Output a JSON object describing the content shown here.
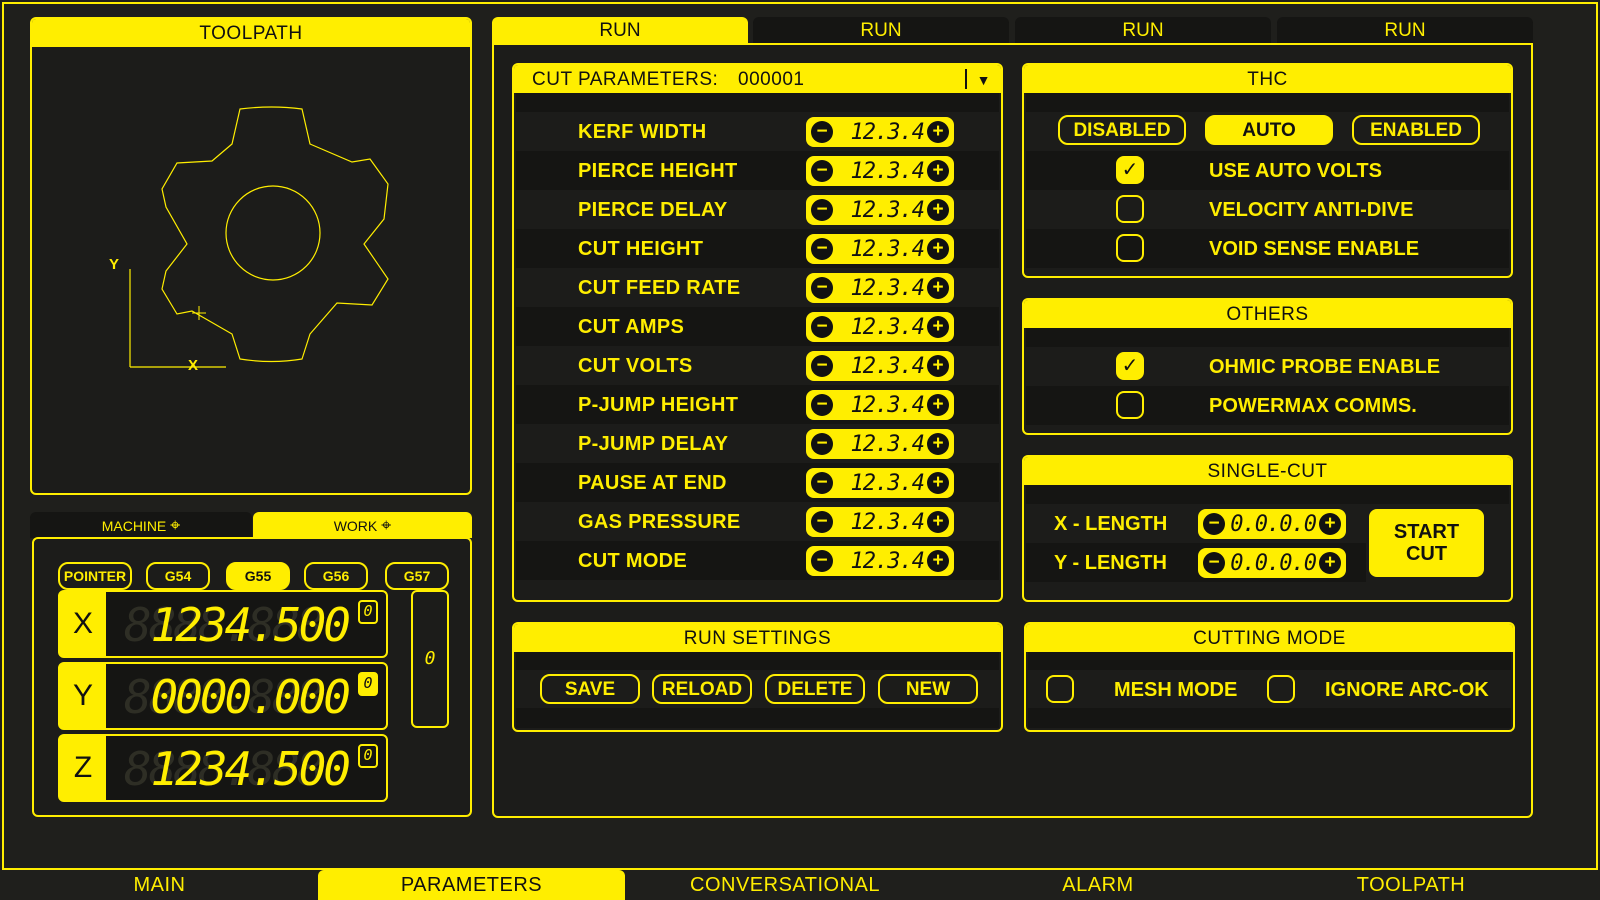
{
  "toolpath_panel": {
    "title": "TOOLPATH",
    "axis_x": "X",
    "axis_y": "Y"
  },
  "coord_tabs": {
    "machine": "MACHINE",
    "work": "WORK"
  },
  "offsets": [
    {
      "label": "POINTER",
      "active": false
    },
    {
      "label": "G54",
      "active": false
    },
    {
      "label": "G55",
      "active": true
    },
    {
      "label": "G56",
      "active": false
    },
    {
      "label": "G57",
      "active": false
    }
  ],
  "dro": [
    {
      "axis": "X",
      "ghost": "8888.888",
      "value": "1234.500",
      "mini": "0",
      "mini_active": false
    },
    {
      "axis": "Y",
      "ghost": "8888.888",
      "value": "0000.000",
      "mini": "0",
      "mini_active": true
    },
    {
      "axis": "Z",
      "ghost": "8888.888",
      "value": "1234.500",
      "mini": "0",
      "mini_active": false
    }
  ],
  "dro_side_value": "0",
  "run_tabs": [
    "RUN",
    "RUN",
    "RUN",
    "RUN"
  ],
  "cut_params": {
    "title": "CUT PARAMETERS:",
    "id": "000001",
    "rows": [
      {
        "label": "KERF WIDTH",
        "value": "12.3.4"
      },
      {
        "label": "PIERCE HEIGHT",
        "value": "12.3.4"
      },
      {
        "label": "PIERCE DELAY",
        "value": "12.3.4"
      },
      {
        "label": "CUT HEIGHT",
        "value": "12.3.4"
      },
      {
        "label": "CUT FEED RATE",
        "value": "12.3.4"
      },
      {
        "label": "CUT AMPS",
        "value": "12.3.4"
      },
      {
        "label": "CUT VOLTS",
        "value": "12.3.4"
      },
      {
        "label": "P-JUMP HEIGHT",
        "value": "12.3.4"
      },
      {
        "label": "P-JUMP DELAY",
        "value": "12.3.4"
      },
      {
        "label": "PAUSE AT END",
        "value": "12.3.4"
      },
      {
        "label": "GAS PRESSURE",
        "value": "12.3.4"
      },
      {
        "label": "CUT MODE",
        "value": "12.3.4"
      }
    ]
  },
  "thc": {
    "title": "THC",
    "modes": [
      {
        "label": "DISABLED",
        "active": false
      },
      {
        "label": "AUTO",
        "active": true
      },
      {
        "label": "ENABLED",
        "active": false
      }
    ],
    "options": [
      {
        "label": "USE AUTO VOLTS",
        "checked": true
      },
      {
        "label": "VELOCITY ANTI-DIVE",
        "checked": false
      },
      {
        "label": "VOID SENSE ENABLE",
        "checked": false
      }
    ]
  },
  "others": {
    "title": "OTHERS",
    "options": [
      {
        "label": "OHMIC PROBE ENABLE",
        "checked": true
      },
      {
        "label": "POWERMAX COMMS.",
        "checked": false
      }
    ]
  },
  "single_cut": {
    "title": "SINGLE-CUT",
    "x_label": "X - LENGTH",
    "x_value": "0.0.0.0",
    "y_label": "Y - LENGTH",
    "y_value": "0.0.0.0",
    "start_line1": "START",
    "start_line2": "CUT"
  },
  "run_settings": {
    "title": "RUN SETTINGS",
    "buttons": [
      "SAVE",
      "RELOAD",
      "DELETE",
      "NEW"
    ]
  },
  "cutting_mode": {
    "title": "CUTTING MODE",
    "options": [
      {
        "label": "MESH MODE",
        "checked": false
      },
      {
        "label": "IGNORE ARC-OK",
        "checked": false
      }
    ]
  },
  "bottom_tabs": [
    {
      "label": "MAIN",
      "active": false
    },
    {
      "label": "PARAMETERS",
      "active": true
    },
    {
      "label": "CONVERSATIONAL",
      "active": false
    },
    {
      "label": "ALARM",
      "active": false
    },
    {
      "label": "TOOLPATH",
      "active": false
    }
  ],
  "colors": {
    "accent": "#ffee00",
    "background": "#1f1f1c",
    "row_dark": "#151513"
  }
}
